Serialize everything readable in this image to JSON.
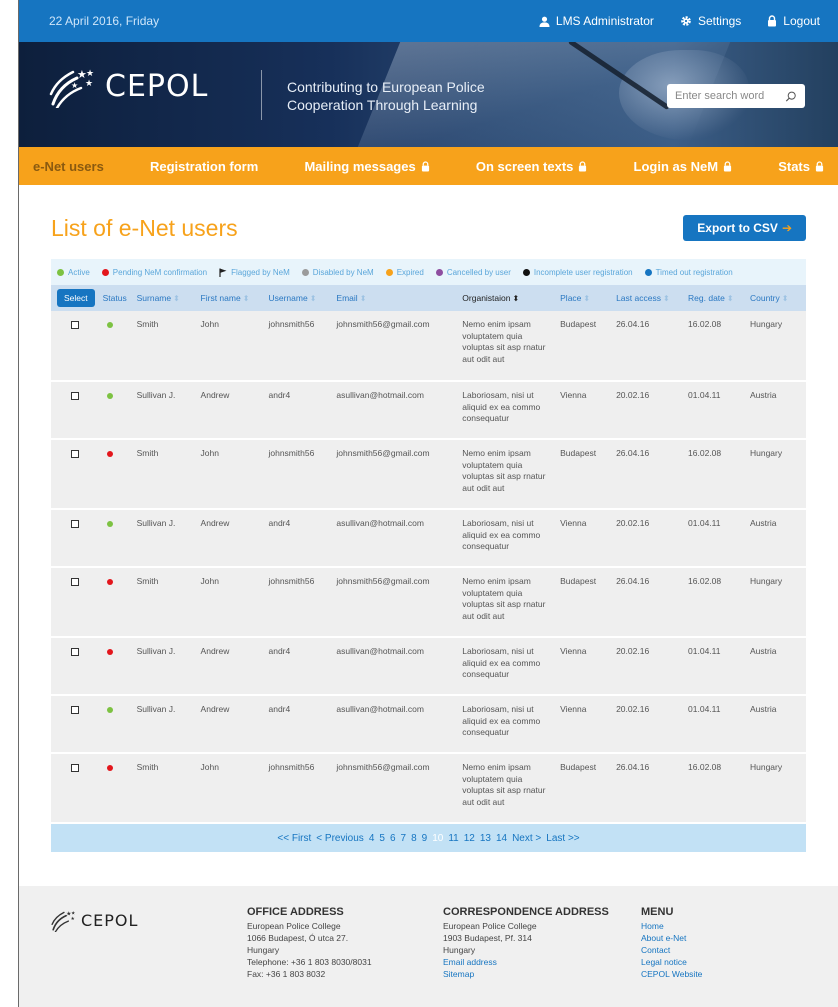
{
  "topbar": {
    "date": "22 April 2016, Friday",
    "user_label": "LMS Administrator",
    "settings_label": "Settings",
    "logout_label": "Logout"
  },
  "header": {
    "logo_text": "CEPOL",
    "tagline": "Contributing to European Police Cooperation Through Learning",
    "search_placeholder": "Enter search word"
  },
  "nav": {
    "items": [
      {
        "label": "e-Net users",
        "locked": false,
        "active": true
      },
      {
        "label": "Registration form",
        "locked": false,
        "active": false
      },
      {
        "label": "Mailing messages",
        "locked": true,
        "active": false
      },
      {
        "label": "On screen texts",
        "locked": true,
        "active": false
      },
      {
        "label": "Login as NeM",
        "locked": true,
        "active": false
      },
      {
        "label": "Stats",
        "locked": true,
        "active": false
      }
    ]
  },
  "page": {
    "title": "List of e-Net users",
    "export_label": "Export to CSV"
  },
  "legend": [
    {
      "label": "Active",
      "color": "#7dc242",
      "icon": "dot"
    },
    {
      "label": "Pending NeM confirmation",
      "color": "#e3161c",
      "icon": "dot"
    },
    {
      "label": "Flagged by NeM",
      "color": "#222222",
      "icon": "flag-icon"
    },
    {
      "label": "Disabled by NeM",
      "color": "#9b9b9b",
      "icon": "dot"
    },
    {
      "label": "Expired",
      "color": "#f7a21b",
      "icon": "dot"
    },
    {
      "label": "Cancelled by user",
      "color": "#8e4ea0",
      "icon": "dot"
    },
    {
      "label": "Incomplete user registration",
      "color": "#111111",
      "icon": "dot"
    },
    {
      "label": "Timed out registration",
      "color": "#1675c1",
      "icon": "dot"
    }
  ],
  "table": {
    "select_label": "Select",
    "columns": [
      "Status",
      "Surname",
      "First name",
      "Username",
      "Email",
      "Organistaion",
      "Place",
      "Last access",
      "Reg. date",
      "Country"
    ],
    "rows": [
      {
        "status": "#7dc242",
        "surname": "Smith",
        "first": "John",
        "username": "johnsmith56",
        "email": "johnsmith56@gmail.com",
        "org": "Nemo enim ipsam voluptatem quia voluptas sit asp rnatur aut odit aut",
        "place": "Budapest",
        "last": "26.04.16",
        "reg": "16.02.08",
        "country": "Hungary"
      },
      {
        "status": "#7dc242",
        "surname": "Sullivan J.",
        "first": "Andrew",
        "username": "andr4",
        "email": "asullivan@hotmail.com",
        "org": "Laboriosam, nisi ut aliquid ex ea commo consequatur",
        "place": "Vienna",
        "last": "20.02.16",
        "reg": "01.04.11",
        "country": "Austria"
      },
      {
        "status": "#e3161c",
        "surname": "Smith",
        "first": "John",
        "username": "johnsmith56",
        "email": "johnsmith56@gmail.com",
        "org": "Nemo enim ipsam voluptatem quia voluptas sit asp rnatur aut odit aut",
        "place": "Budapest",
        "last": "26.04.16",
        "reg": "16.02.08",
        "country": "Hungary"
      },
      {
        "status": "#7dc242",
        "surname": "Sullivan J.",
        "first": "Andrew",
        "username": "andr4",
        "email": "asullivan@hotmail.com",
        "org": "Laboriosam, nisi ut aliquid ex ea commo consequatur",
        "place": "Vienna",
        "last": "20.02.16",
        "reg": "01.04.11",
        "country": "Austria"
      },
      {
        "status": "#e3161c",
        "surname": "Smith",
        "first": "John",
        "username": "johnsmith56",
        "email": "johnsmith56@gmail.com",
        "org": "Nemo enim ipsam voluptatem quia voluptas sit asp rnatur aut odit aut",
        "place": "Budapest",
        "last": "26.04.16",
        "reg": "16.02.08",
        "country": "Hungary"
      },
      {
        "status": "#e3161c",
        "surname": "Sullivan J.",
        "first": "Andrew",
        "username": "andr4",
        "email": "asullivan@hotmail.com",
        "org": "Laboriosam, nisi ut aliquid ex ea commo consequatur",
        "place": "Vienna",
        "last": "20.02.16",
        "reg": "01.04.11",
        "country": "Austria"
      },
      {
        "status": "#7dc242",
        "surname": "Sullivan J.",
        "first": "Andrew",
        "username": "andr4",
        "email": "asullivan@hotmail.com",
        "org": "Laboriosam, nisi ut aliquid ex ea commo consequatur",
        "place": "Vienna",
        "last": "20.02.16",
        "reg": "01.04.11",
        "country": "Austria"
      },
      {
        "status": "#e3161c",
        "surname": "Smith",
        "first": "John",
        "username": "johnsmith56",
        "email": "johnsmith56@gmail.com",
        "org": "Nemo enim ipsam voluptatem quia voluptas sit asp rnatur aut odit aut",
        "place": "Budapest",
        "last": "26.04.16",
        "reg": "16.02.08",
        "country": "Hungary"
      }
    ]
  },
  "pager": {
    "first": "<< First",
    "previous": "< Previous",
    "pages": [
      "4",
      "5",
      "6",
      "7",
      "8",
      "9",
      "10",
      "11",
      "12",
      "13",
      "14"
    ],
    "current": "10",
    "next": "Next >",
    "last": "Last >>"
  },
  "footer": {
    "logo_text": "CEPOL",
    "office": {
      "heading": "OFFICE ADDRESS",
      "lines": [
        "European Police College",
        "1066 Budapest, Ó utca 27.",
        "Hungary",
        "Telephone: +36 1 803 8030/8031",
        "Fax: +36 1 803 8032"
      ]
    },
    "correspondence": {
      "heading": "CORRESPONDENCE ADDRESS",
      "lines": [
        "European Police College",
        "1903 Budapest, Pf. 314",
        "Hungary"
      ],
      "links": [
        "Email address",
        "Sitemap"
      ]
    },
    "menu": {
      "heading": "MENU",
      "links": [
        "Home",
        "About e-Net",
        "Contact",
        "Legal notice",
        "CEPOL Website"
      ]
    }
  }
}
